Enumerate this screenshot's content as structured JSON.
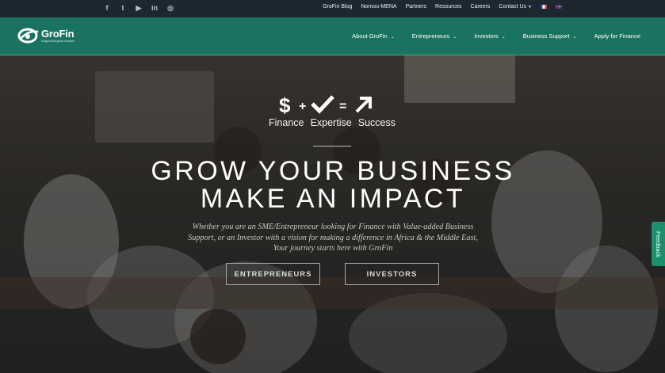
{
  "topbar": {
    "social": [
      "f",
      "t",
      "▶",
      "in",
      "◎"
    ],
    "links": [
      "GroFin Blog",
      "Nomou-MENA",
      "Partners",
      "Resources",
      "Careers",
      "Contact Us"
    ]
  },
  "brand": {
    "name": "GroFin",
    "tagline": "Support beyond finance",
    "logo_color": "#ffffff"
  },
  "nav": {
    "items": [
      {
        "label": "About GroFin",
        "dropdown": true
      },
      {
        "label": "Entrepreneurs",
        "dropdown": true
      },
      {
        "label": "Investors",
        "dropdown": true
      },
      {
        "label": "Business Support",
        "dropdown": true
      },
      {
        "label": "Apply for Finance",
        "dropdown": false
      }
    ],
    "accent": "#187864"
  },
  "hero": {
    "words": [
      "Finance",
      "Expertise",
      "Success"
    ],
    "headline_1": "GROW YOUR BUSINESS",
    "headline_2": "MAKE AN IMPACT",
    "lead_1": "Whether you are an SME/Entrepreneur looking for Finance with Value-added Business",
    "lead_2": "Support, or an Investor with a vision for making a difference in Africa & the Middle East,",
    "lead_3": "Your journey starts here with GroFin",
    "btn_entrepreneurs": "ENTREPRENEURS",
    "btn_investors": "INVESTORS"
  },
  "feedback": "Feedback"
}
